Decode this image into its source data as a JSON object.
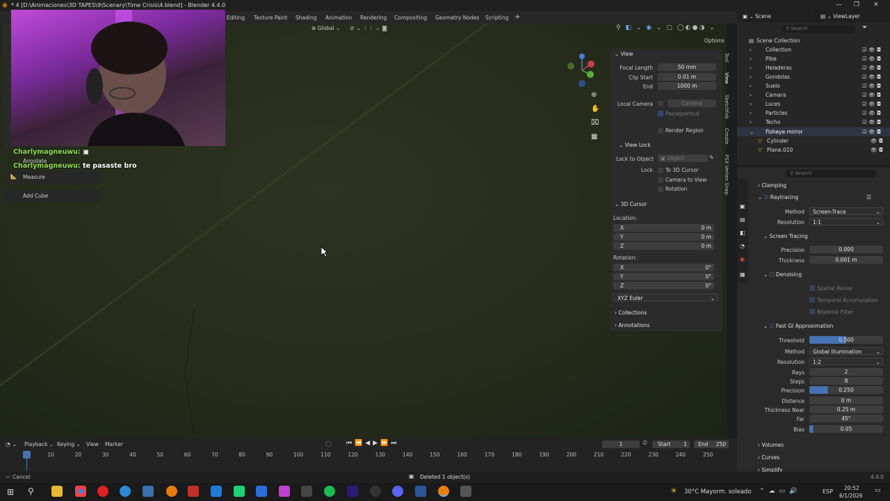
{
  "window": {
    "title": "* 4 [D:\\Animaciones\\3D TAPES\\9\\Scenary\\Time Crisis\\4.blend] - Blender 4.4.0",
    "controls": [
      "—",
      "❐",
      "✕"
    ]
  },
  "workspaces": [
    "Editing",
    "Texture Paint",
    "Shading",
    "Animation",
    "Rendering",
    "Compositing",
    "Geometry Nodes",
    "Scripting",
    "+"
  ],
  "viewport_header": {
    "transform_orientation": "Global",
    "options_label": "Options"
  },
  "chat": [
    {
      "user": "Charlymagneuwu:",
      "text": ""
    },
    {
      "user": "Charlymagneuwu:",
      "text": "te pasaste bro"
    }
  ],
  "tools": [
    {
      "label": "Annotate"
    },
    {
      "label": "Measure"
    },
    {
      "label": "Add Cube"
    }
  ],
  "npanel": {
    "view": {
      "title": "View",
      "focal_length_label": "Focal Length",
      "focal_length": "50 mm",
      "clip_start_label": "Clip Start",
      "clip_start": "0.01 m",
      "end_label": "End",
      "end": "1000 m",
      "local_camera_label": "Local Camera",
      "camera_placeholder": "Camera",
      "passepartout": "Passepartout",
      "render_region": "Render Region"
    },
    "view_lock": {
      "title": "View Lock",
      "lock_to_object_label": "Lock to Object",
      "object_placeholder": "Object",
      "lock_label": "Lock",
      "to_3d_cursor": "To 3D Cursor",
      "camera_to_view": "Camera to View",
      "rotation": "Rotation"
    },
    "cursor": {
      "title": "3D Cursor",
      "location_label": "Location:",
      "x_label": "X",
      "x": "0 m",
      "y_label": "Y",
      "y": "0 m",
      "z_label": "Z",
      "z": "0 m",
      "rotation_label": "Rotation:",
      "rx_label": "X",
      "rx": "0°",
      "ry_label": "Y",
      "ry": "0°",
      "rz_label": "Z",
      "rz": "0°",
      "euler": "XYZ Euler"
    },
    "collections": "Collections",
    "annotations": "Annotations"
  },
  "sidebar_tabs": [
    "Tool",
    "View",
    "Sketchfab",
    "Create",
    "PSX Vertex Snap"
  ],
  "outliner": {
    "scene_label": "Scene",
    "view_layer": "ViewLayer",
    "search_placeholder": "Search",
    "root": "Scene Collection",
    "items": [
      {
        "name": "Collection"
      },
      {
        "name": "Pibe"
      },
      {
        "name": "Heladeras"
      },
      {
        "name": "Gondolas"
      },
      {
        "name": "Suelo"
      },
      {
        "name": "Camara"
      },
      {
        "name": "Luces"
      },
      {
        "name": "Particles"
      },
      {
        "name": "Techo"
      },
      {
        "name": "Fisheye mirror"
      },
      {
        "name": "Cylinder"
      },
      {
        "name": "Plane.010"
      }
    ]
  },
  "properties": {
    "search_placeholder": "Search",
    "clamping": "Clamping",
    "raytracing": "Raytracing",
    "method_label": "Method",
    "method": "Screen-Trace",
    "resolution_label": "Resolution",
    "resolution": "1:1",
    "screen_tracing": "Screen Tracing",
    "precision_label": "Precision",
    "precision": "0.000",
    "thickness_label": "Thickness",
    "thickness": "0.001 m",
    "denoising": "Denoising",
    "spatial_reuse": "Spatial Reuse",
    "temporal_accumulation": "Temporal Accumulation",
    "bilateral_filter": "Bilateral Filter",
    "fast_gi": "Fast GI Approximation",
    "threshold_label": "Threshold",
    "threshold": "0.500",
    "gi_method_label": "Method",
    "gi_method": "Global Illumination",
    "gi_resolution_label": "Resolution",
    "gi_resolution": "1:2",
    "rays_label": "Rays",
    "rays": "2",
    "steps_label": "Steps",
    "steps": "8",
    "gi_precision_label": "Precision",
    "gi_precision": "0.250",
    "distance_label": "Distance",
    "distance": "0 m",
    "thickness_near_label": "Thickness Near",
    "thickness_near": "0.25 m",
    "far_label": "Far",
    "far": "45°",
    "bias_label": "Bias",
    "bias": "0.05",
    "volumes": "Volumes",
    "curves": "Curves",
    "simplify": "Simplify"
  },
  "timeline": {
    "menus": [
      "Playback",
      "Keying",
      "View",
      "Marker"
    ],
    "current_frame": "1",
    "start_label": "Start",
    "start": "1",
    "end_label": "End",
    "end": "250",
    "ticks": [
      "1",
      "10",
      "20",
      "30",
      "40",
      "50",
      "60",
      "70",
      "80",
      "90",
      "100",
      "110",
      "120",
      "130",
      "140",
      "150",
      "160",
      "170",
      "180",
      "190",
      "200",
      "210",
      "220",
      "230",
      "240",
      "250"
    ]
  },
  "status": {
    "left": "Cancel",
    "message": "Deleted 1 object(s)",
    "version": "4.4.0"
  },
  "taskbar": {
    "weather": "30°C  Mayorm. soleado",
    "lang": "ESP",
    "time": "20:52",
    "date": "6/1/2026"
  },
  "colors": {
    "accent": "#4772b3",
    "chat_user": "#8fdc5a",
    "viewport_bg": "#2a311e"
  }
}
